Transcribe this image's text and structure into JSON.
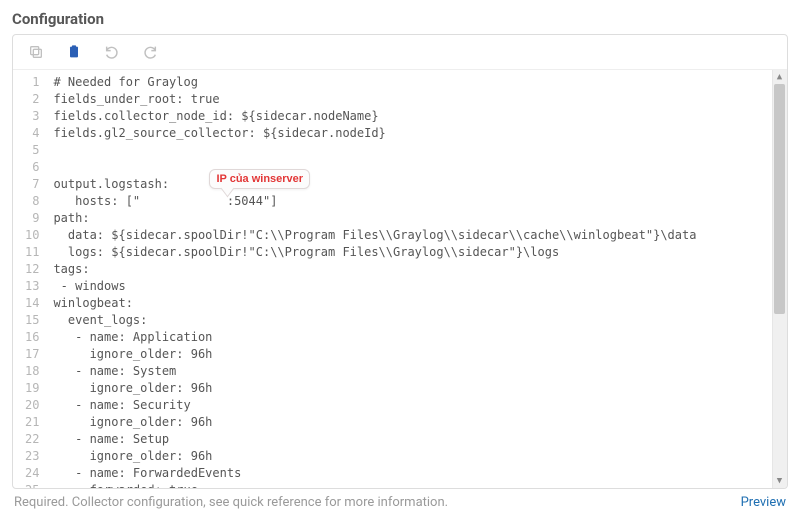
{
  "title": "Configuration",
  "toolbar": {
    "copy_icon": "copy",
    "paste_icon": "paste",
    "undo_icon": "undo",
    "redo_icon": "redo"
  },
  "callout_text": "IP của winserver",
  "code_lines": [
    "# Needed for Graylog",
    "fields_under_root: true",
    "fields.collector_node_id: ${sidecar.nodeName}",
    "fields.gl2_source_collector: ${sidecar.nodeId}",
    "",
    "",
    "output.logstash:",
    "   hosts: [\"            :5044\"]",
    "path:",
    "  data: ${sidecar.spoolDir!\"C:\\\\Program Files\\\\Graylog\\\\sidecar\\\\cache\\\\winlogbeat\"}\\data",
    "  logs: ${sidecar.spoolDir!\"C:\\\\Program Files\\\\Graylog\\\\sidecar\"}\\logs",
    "tags:",
    " - windows",
    "winlogbeat:",
    "  event_logs:",
    "   - name: Application",
    "     ignore_older: 96h",
    "   - name: System",
    "     ignore_older: 96h",
    "   - name: Security",
    "     ignore_older: 96h",
    "   - name: Setup",
    "     ignore_older: 96h",
    "   - name: ForwardedEvents",
    "     forwarded: true"
  ],
  "help_text": "Required. Collector configuration, see quick reference for more information.",
  "preview_label": "Preview"
}
